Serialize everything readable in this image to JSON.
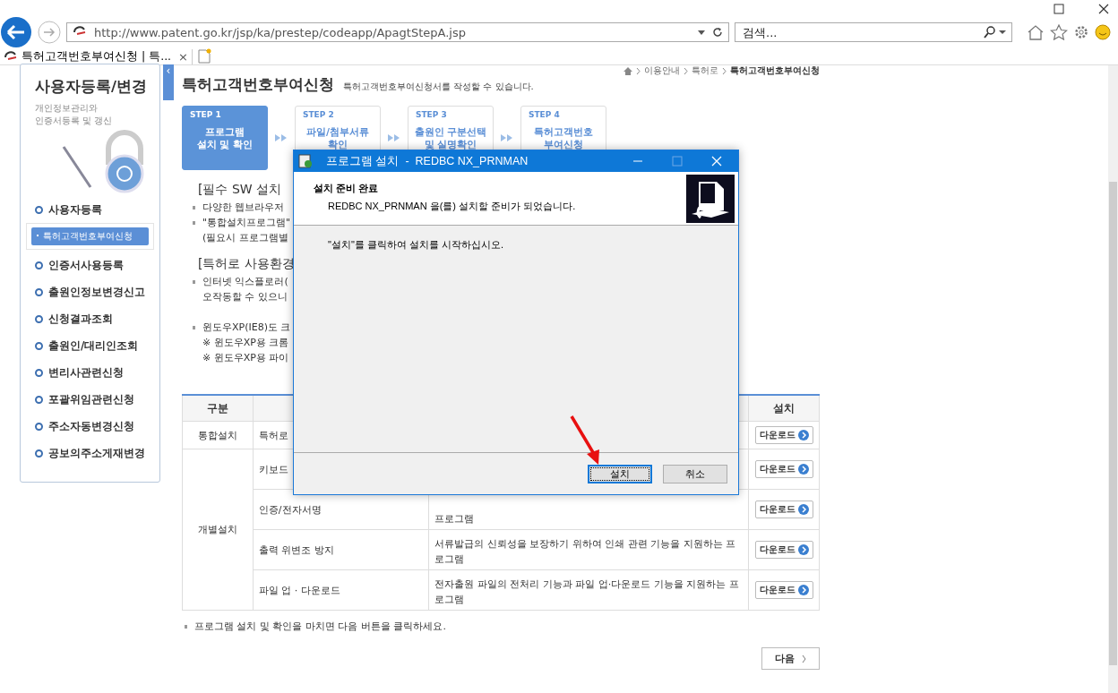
{
  "browser": {
    "address": "http://www.patent.go.kr/jsp/ka/prestep/codeapp/ApagtStepA.jsp",
    "search_placeholder": "검색...",
    "tabs": [
      {
        "label": "특허고객번호부여신청 | 특...",
        "close": "×",
        "selected": true
      }
    ]
  },
  "sidebar": {
    "title": "사용자등록/변경",
    "subtitle": [
      "개인정보관리와",
      "인증서등록 및 갱신"
    ],
    "collapse": "‹",
    "items": [
      {
        "label": "사용자등록",
        "selected": false,
        "children": [
          {
            "label": "특허고객번호부여신청",
            "selected": true
          }
        ]
      },
      {
        "label": "인증서사용등록",
        "selected": false
      },
      {
        "label": "출원인정보변경신고",
        "selected": false
      },
      {
        "label": "신청결과조회",
        "selected": false
      },
      {
        "label": "출원인/대리인조회",
        "selected": false
      },
      {
        "label": "변리사관련신청",
        "selected": false
      },
      {
        "label": "포괄위임관련신청",
        "selected": false
      },
      {
        "label": "주소자동변경신청",
        "selected": false
      },
      {
        "label": "공보의주소게재변경",
        "selected": false
      }
    ]
  },
  "breadcrumb": [
    "이용안내",
    "특허로",
    "특허고객번호부여신청"
  ],
  "page": {
    "title": "특허고객번호부여신청",
    "description": "특허고객번호부여신청서를 작성할 수 있습니다."
  },
  "steps": [
    {
      "step": "STEP 1",
      "label": [
        "프로그램",
        "설치 및 확인"
      ],
      "selected": true
    },
    {
      "step": "STEP 2",
      "label": [
        "파일/첨부서류",
        "확인"
      ],
      "selected": false
    },
    {
      "step": "STEP 3",
      "label": [
        "출원인 구분선택",
        "및 실명확인"
      ],
      "selected": false
    },
    {
      "step": "STEP 4",
      "label": [
        "특허고객번호",
        "부여신청"
      ],
      "selected": false
    }
  ],
  "sections": [
    {
      "heading": "[필수 SW 설치",
      "lines": [
        {
          "text": "다양한 웹브라우저",
          "bullet": true
        },
        {
          "text": "\"통합설치프로그램\"",
          "bullet": true
        },
        {
          "text": "(필요시 프로그램별",
          "bullet": false
        }
      ]
    },
    {
      "heading": "[특허로 사용환경",
      "lines": [
        {
          "text": "인터넷 익스플로러(",
          "bullet": true
        },
        {
          "text": "오작동할 수 있으니",
          "bullet": false
        },
        {
          "text": "윈도우XP(IE8)도 크",
          "bullet": true
        },
        {
          "text": "※ 윈도우XP용 크롬",
          "bullet": false
        },
        {
          "text": "※ 윈도우XP용 파이",
          "bullet": false
        }
      ]
    }
  ],
  "table": {
    "columns": [
      "구분",
      "설치"
    ],
    "groups": [
      {
        "label": "통합설치",
        "rows": [
          {
            "name": "특허로",
            "button": "다운로드"
          }
        ]
      },
      {
        "label": "개별설치",
        "rows": [
          {
            "name": "키보드",
            "button": "다운로드"
          },
          {
            "name": "인증/전자서명",
            "description": "프로그램",
            "button": "다운로드"
          },
          {
            "name": "출력 위변조 방지",
            "description": "서류발급의 신뢰성을 보장하기 위하여 인쇄 관련 기능을 지원하는 프로그램",
            "button": "다운로드"
          },
          {
            "name": "파일 업 · 다운로드",
            "description": "전자출원 파일의 전처리 기능과 파일 업·다운로드 기능을 지원하는 프로그램",
            "button": "다운로드"
          }
        ]
      }
    ]
  },
  "note": "프로그램 설치 및 확인을 마치면 다음 버튼을 클릭하세요.",
  "next_button": "다음",
  "dialog": {
    "title": "프로그램 설치  -  REDBC NX_PRNMAN",
    "heading": "설치 준비 완료",
    "subheading": "REDBC NX_PRNMAN 을(를) 설치할 준비가 되었습니다.",
    "message": "\"설치\"를 클릭하여 설치를 시작하십시오.",
    "buttons": [
      {
        "label": "설치",
        "focused": true
      },
      {
        "label": "취소",
        "focused": false
      }
    ]
  }
}
